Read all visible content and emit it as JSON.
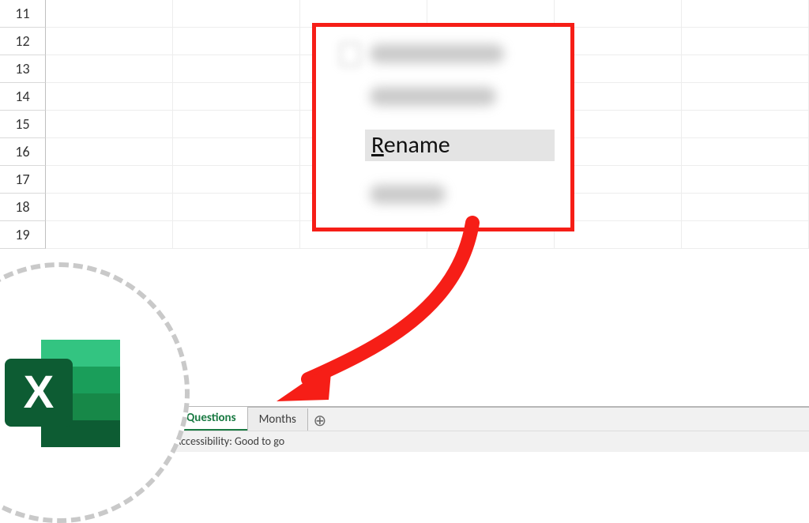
{
  "rows": [
    "11",
    "12",
    "13",
    "14",
    "15",
    "16",
    "17",
    "18",
    "19"
  ],
  "tabs": {
    "active": "Questions",
    "inactive": "Months"
  },
  "newtab_glyph": "⊕",
  "statusbar": {
    "text": "Accessibility: Good to go"
  },
  "context_menu": {
    "rename_label": "Rename",
    "rename_prefix": "R",
    "rename_suffix": "ename"
  },
  "logo": {
    "glyph": "X"
  },
  "colors": {
    "accent_red": "#f61e17",
    "excel_green": "#1a7a43",
    "excel_green_dark": "#0d5c33",
    "excel_green_light": "#33c481"
  }
}
